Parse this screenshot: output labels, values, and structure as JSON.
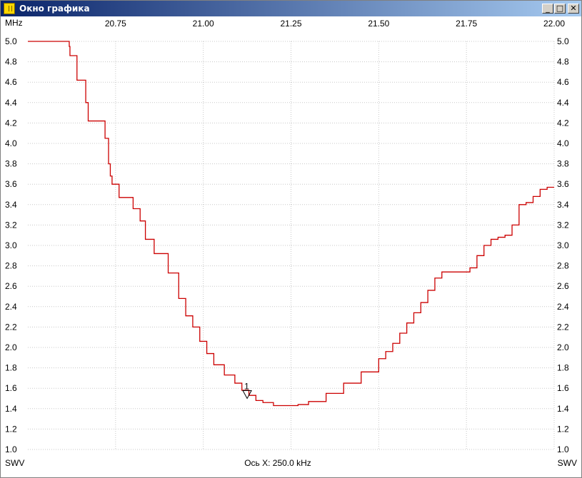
{
  "window": {
    "title": "Окно графика",
    "icons": {
      "app": "app-icon",
      "minimize": "minimize-icon",
      "maximize": "maximize-icon",
      "close": "close-icon"
    },
    "minimize_glyph": "_",
    "maximize_glyph": "□",
    "close_glyph": "✕"
  },
  "colors": {
    "trace": "#cc0000",
    "grid": "#c8c8c8",
    "titlebar": "#0a246a"
  },
  "labels": {
    "x_unit": "MHz",
    "y_left": "SWV",
    "y_right": "SWV",
    "x_axis_info": "Ось X: 250.0 kHz"
  },
  "chart_data": {
    "type": "line",
    "xlim": [
      20.5,
      22.0
    ],
    "ylim": [
      1.0,
      5.0
    ],
    "x_ticks": [
      "20.75",
      "21.00",
      "21.25",
      "21.50",
      "21.75",
      "22.00"
    ],
    "x_tick_values": [
      20.75,
      21.0,
      21.25,
      21.5,
      21.75,
      22.0
    ],
    "y_ticks": [
      "5.0",
      "4.8",
      "4.6",
      "4.4",
      "4.2",
      "4.0",
      "3.8",
      "3.6",
      "3.4",
      "3.2",
      "3.0",
      "2.8",
      "2.6",
      "2.4",
      "2.2",
      "2.0",
      "1.8",
      "1.6",
      "1.4",
      "1.2",
      "1.0"
    ],
    "y_tick_values": [
      5.0,
      4.8,
      4.6,
      4.4,
      4.2,
      4.0,
      3.8,
      3.6,
      3.4,
      3.2,
      3.0,
      2.8,
      2.6,
      2.4,
      2.2,
      2.0,
      1.8,
      1.6,
      1.4,
      1.2,
      1.0
    ],
    "grid": true,
    "series": [
      {
        "x": [
          20.5,
          20.615,
          20.618,
          20.62,
          20.625,
          20.64,
          20.66,
          20.665,
          20.672,
          20.715,
          20.72,
          20.73,
          20.735,
          20.74,
          20.76,
          20.79,
          20.8,
          20.82,
          20.835,
          20.855,
          20.86,
          20.9,
          20.91,
          20.93,
          20.94,
          20.95,
          20.97,
          20.99,
          21.01,
          21.03,
          21.06,
          21.09,
          21.11,
          21.13,
          21.15,
          21.17,
          21.2,
          21.23,
          21.25,
          21.27,
          21.3,
          21.35,
          21.4,
          21.45,
          21.5,
          21.52,
          21.54,
          21.56,
          21.58,
          21.6,
          21.62,
          21.64,
          21.66,
          21.68,
          21.7,
          21.72,
          21.74,
          21.76,
          21.78,
          21.8,
          21.82,
          21.84,
          21.86,
          21.88,
          21.9,
          21.92,
          21.94,
          21.96,
          21.98,
          22.0
        ],
        "y": [
          5.0,
          5.0,
          4.95,
          4.86,
          4.86,
          4.62,
          4.62,
          4.4,
          4.22,
          4.22,
          4.05,
          3.8,
          3.68,
          3.6,
          3.47,
          3.47,
          3.36,
          3.24,
          3.06,
          3.06,
          2.92,
          2.73,
          2.73,
          2.48,
          2.48,
          2.31,
          2.2,
          2.06,
          1.94,
          1.83,
          1.73,
          1.65,
          1.58,
          1.53,
          1.48,
          1.46,
          1.43,
          1.43,
          1.43,
          1.44,
          1.47,
          1.55,
          1.65,
          1.76,
          1.89,
          1.96,
          2.04,
          2.14,
          2.24,
          2.34,
          2.44,
          2.56,
          2.68,
          2.74,
          2.74,
          2.74,
          2.74,
          2.78,
          2.9,
          3.0,
          3.06,
          3.08,
          3.1,
          3.2,
          3.4,
          3.42,
          3.48,
          3.55,
          3.57,
          3.57
        ]
      }
    ],
    "marker": {
      "label": "1",
      "x": 21.125,
      "y": 1.5
    }
  }
}
